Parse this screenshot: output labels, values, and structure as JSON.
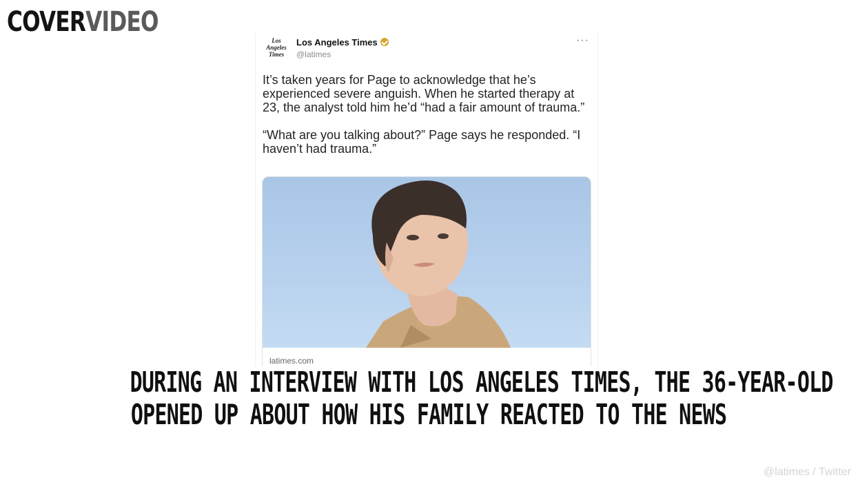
{
  "brand": {
    "part1": "COVER",
    "part2": "VIDEO"
  },
  "tweet": {
    "logo_text": [
      "Los",
      "Angeles",
      "Times"
    ],
    "account_name": "Los Angeles Times",
    "handle": "@latimes",
    "more_label": "···",
    "paragraphs": [
      "It’s taken years for Page to acknowledge that he’s experienced severe anguish. When he started therapy at 23, the analyst told him he’d “had a fair amount of trauma.”",
      "“What are you talking about?” Page says he responded. “I haven’t had trauma.”"
    ],
    "card_domain": "latimes.com"
  },
  "caption": {
    "line1": "DURING AN INTERVIEW WITH LOS ANGELES TIMES, THE 36-YEAR-OLD",
    "line2": "OPENED UP ABOUT HOW HIS FAMILY REACTED TO THE NEWS"
  },
  "credit": "@latimes / Twitter",
  "colors": {
    "verified_badge": "#d4a72c",
    "photo_sky": "#b8d2ee"
  }
}
